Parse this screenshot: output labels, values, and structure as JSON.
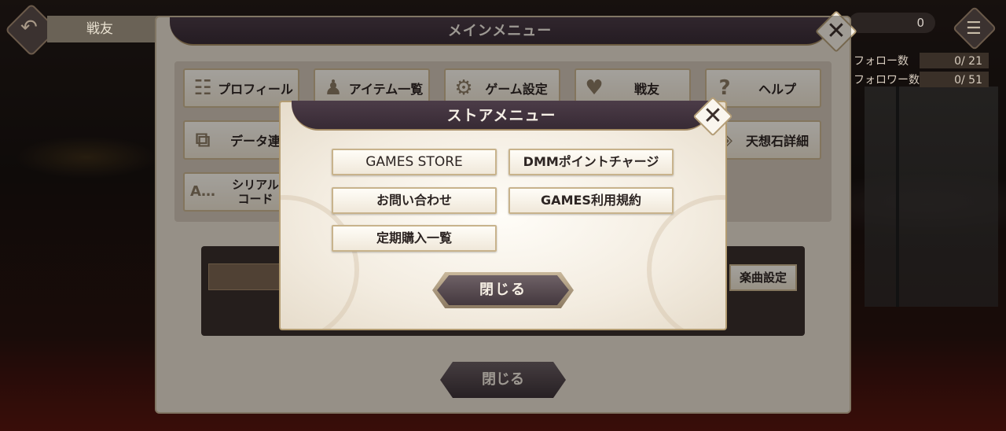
{
  "topbar": {
    "title": "戦友",
    "counter": "0"
  },
  "stats": [
    {
      "label": "フォロー数",
      "value": "0/ 21"
    },
    {
      "label": "フォロワー数",
      "value": "0/ 51"
    }
  ],
  "main_menu": {
    "title": "メインメニュー",
    "items": [
      {
        "label": "プロフィール",
        "icon": "profile-icon"
      },
      {
        "label": "アイテム一覧",
        "icon": "item-bag-icon"
      },
      {
        "label": "ゲーム設定",
        "icon": "gear-icon"
      },
      {
        "label": "戦友",
        "icon": "friends-icon"
      },
      {
        "label": "ヘルプ",
        "icon": "question-icon"
      },
      {
        "label": "データ連",
        "icon": "data-link-icon"
      },
      {
        "label": "天想石詳細",
        "icon": "stone-icon"
      },
      {
        "label": "シリアル\nコード",
        "icon": "serial-code-icon"
      }
    ],
    "music_label": "楽曲設定",
    "close_label": "閉じる"
  },
  "store_menu": {
    "title": "ストアメニュー",
    "buttons": [
      {
        "label": "GAMES STORE"
      },
      {
        "label": "DMMポイントチャージ"
      },
      {
        "label": "お問い合わせ"
      },
      {
        "label": "GAMES利用規約"
      },
      {
        "label": "定期購入一覧"
      }
    ],
    "close_label": "閉じる"
  },
  "colors": {
    "header_bg": "#3f303b",
    "panel_bg": "#f3ece0",
    "border_gold": "#c8b38c"
  }
}
